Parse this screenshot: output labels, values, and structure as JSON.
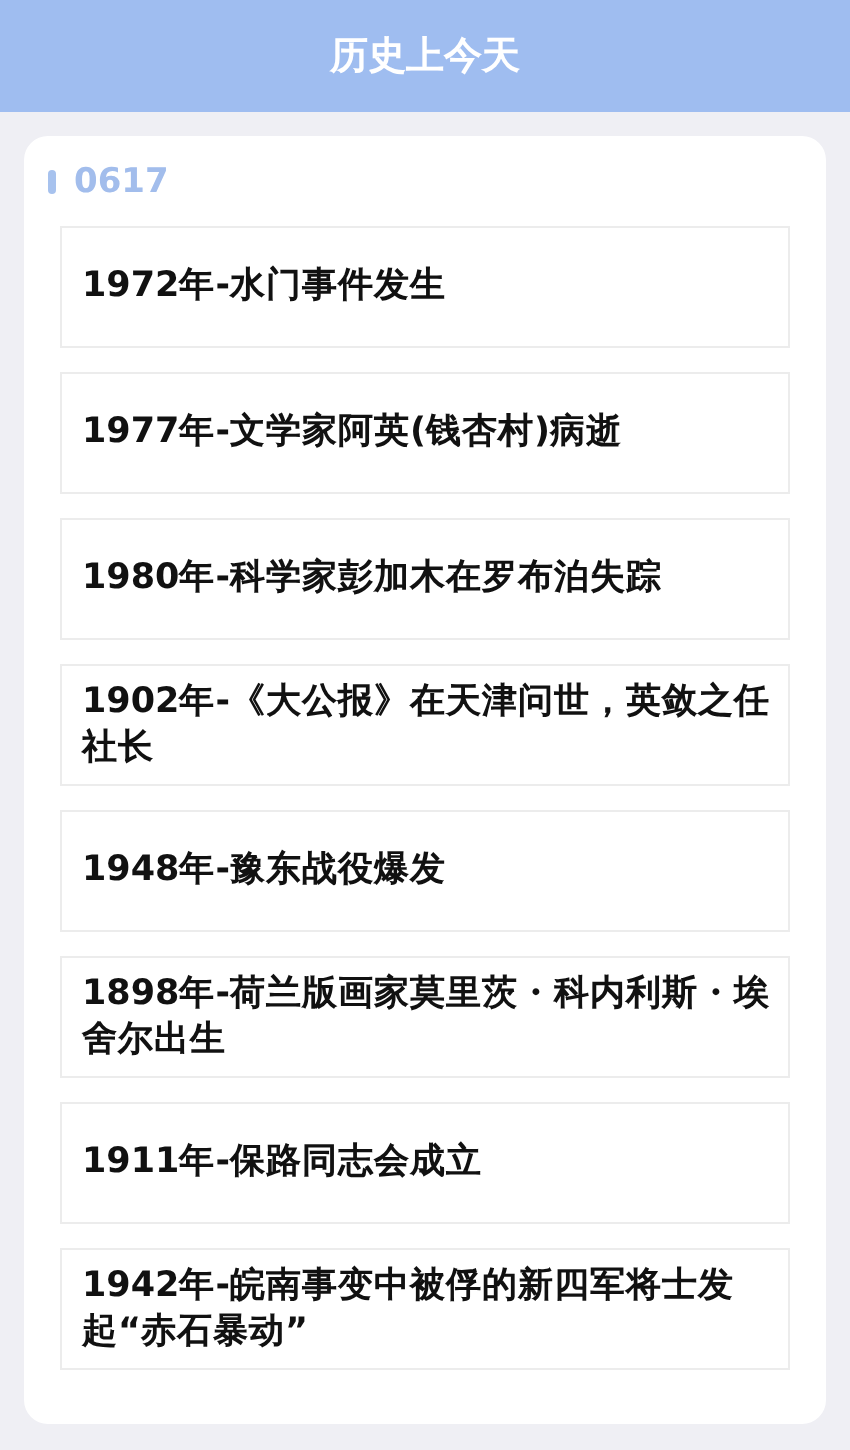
{
  "header": {
    "title": "历史上今天"
  },
  "date": "0617",
  "events": [
    {
      "text": "1972年-水门事件发生"
    },
    {
      "text": "1977年-文学家阿英(钱杏村)病逝"
    },
    {
      "text": "1980年-科学家彭加木在罗布泊失踪"
    },
    {
      "text": "1902年-《大公报》在天津问世，英敛之任社长"
    },
    {
      "text": "1948年-豫东战役爆发"
    },
    {
      "text": "1898年-荷兰版画家莫里茨・科内利斯・埃舍尔出生"
    },
    {
      "text": "1911年-保路同志会成立"
    },
    {
      "text": "1942年-皖南事变中被俘的新四军将士发起“赤石暴动”"
    }
  ]
}
